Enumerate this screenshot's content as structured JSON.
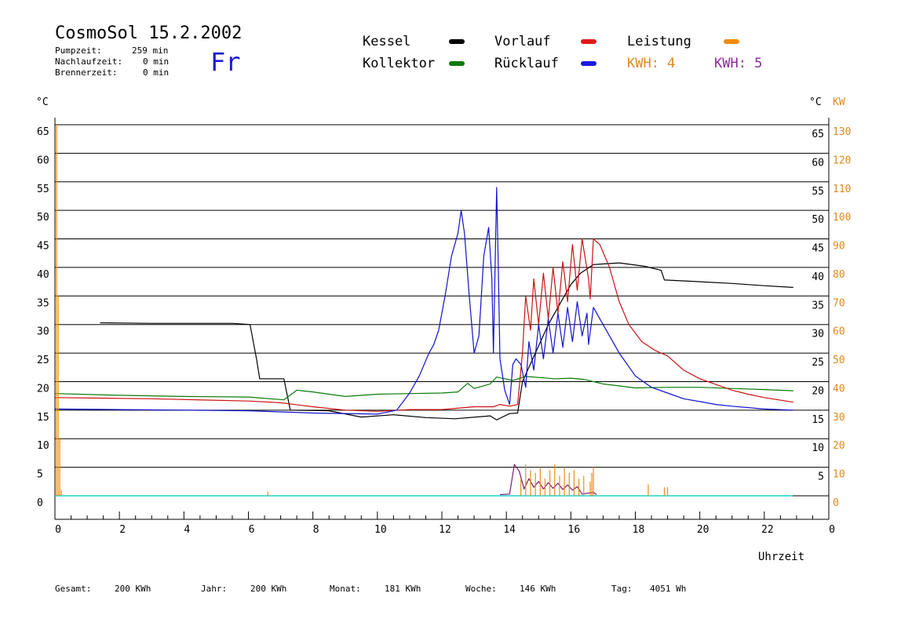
{
  "header": {
    "title": "CosmoSol 15.2.2002",
    "day": "Fr",
    "pump_label": "Pumpzeit:",
    "pump_value": "259 min",
    "nachlauf_label": "Nachlaufzeit:",
    "nachlauf_value": "0 min",
    "brenner_label": "Brennerzeit:",
    "brenner_value": "0 min"
  },
  "legend": {
    "kessel": "Kessel",
    "kollektor": "Kollektor",
    "vorlauf": "Vorlauf",
    "ruecklauf": "Rücklauf",
    "leistung": "Leistung",
    "kwh1": "KWH: 4",
    "kwh2": "KWH: 5"
  },
  "colors": {
    "kessel": "#000000",
    "kollektor": "#0a7a0a",
    "vorlauf": "#cc1111",
    "ruecklauf": "#1111cc",
    "leistung": "#f08c14",
    "kwh1_text": "#e08a20",
    "kwh2_text": "#8a2a9a",
    "kwh2_line": "#7a1a7a",
    "baseline": "#22d0d0"
  },
  "axes": {
    "left_unit": "°C",
    "right_unit_c": "°C",
    "right_unit_kw": "KW",
    "xlabel": "Uhrzeit"
  },
  "footer": {
    "gesamt_label": "Gesamt:",
    "gesamt_value": "200 KWh",
    "jahr_label": "Jahr:",
    "jahr_value": "200 KWh",
    "monat_label": "Monat:",
    "monat_value": "181 KWh",
    "woche_label": "Woche:",
    "woche_value": "146 KWh",
    "tag_label": "Tag:",
    "tag_value": "4051 Wh"
  },
  "chart_data": {
    "type": "line",
    "xlim": [
      0,
      24
    ],
    "ylim": [
      0,
      65
    ],
    "y2lim": [
      0,
      130
    ],
    "grid": true,
    "x_ticks": [
      "0",
      "2",
      "4",
      "6",
      "8",
      "10",
      "12",
      "14",
      "16",
      "18",
      "20",
      "22",
      "0"
    ],
    "y_ticks": [
      "0",
      "5",
      "10",
      "15",
      "20",
      "25",
      "30",
      "35",
      "40",
      "45",
      "50",
      "55",
      "60",
      "65"
    ],
    "y_right_ticks_c": [
      "5",
      "10",
      "15",
      "20",
      "25",
      "30",
      "35",
      "40",
      "45",
      "50",
      "55",
      "60",
      "65"
    ],
    "y_right_ticks_kw": [
      "0",
      "10",
      "20",
      "30",
      "40",
      "50",
      "60",
      "70",
      "80",
      "90",
      "100",
      "110",
      "120",
      "130"
    ],
    "series": [
      {
        "name": "Kessel",
        "color_key": "kessel",
        "points": [
          [
            1.4,
            30.3
          ],
          [
            3,
            30.2
          ],
          [
            5.5,
            30.2
          ],
          [
            6.05,
            30
          ],
          [
            6.25,
            24
          ],
          [
            6.35,
            20.5
          ],
          [
            7.1,
            20.5
          ],
          [
            7.3,
            15
          ],
          [
            8.5,
            14.9
          ],
          [
            9.5,
            13.8
          ],
          [
            10.5,
            14.2
          ],
          [
            11.5,
            13.7
          ],
          [
            12.4,
            13.5
          ],
          [
            13.5,
            14
          ],
          [
            13.7,
            13.3
          ],
          [
            14.1,
            14.4
          ],
          [
            14.35,
            14.5
          ],
          [
            14.5,
            20
          ],
          [
            14.9,
            25
          ],
          [
            15.3,
            30
          ],
          [
            15.7,
            34
          ],
          [
            16,
            37
          ],
          [
            16.3,
            39
          ],
          [
            16.7,
            40.5
          ],
          [
            17.5,
            40.8
          ],
          [
            18.3,
            40.2
          ],
          [
            18.8,
            39.5
          ],
          [
            18.9,
            37.8
          ],
          [
            20,
            37.5
          ],
          [
            21,
            37.2
          ],
          [
            22,
            36.8
          ],
          [
            22.9,
            36.5
          ]
        ]
      },
      {
        "name": "Kollektor",
        "color_key": "kollektor",
        "points": [
          [
            0,
            17.9
          ],
          [
            2,
            17.6
          ],
          [
            4,
            17.4
          ],
          [
            6,
            17.3
          ],
          [
            7.1,
            16.8
          ],
          [
            7.5,
            18.5
          ],
          [
            8,
            18.2
          ],
          [
            9,
            17.4
          ],
          [
            10,
            17.8
          ],
          [
            11,
            17.9
          ],
          [
            12,
            18
          ],
          [
            12.5,
            18.2
          ],
          [
            12.8,
            19.7
          ],
          [
            13,
            18.8
          ],
          [
            13.5,
            19.6
          ],
          [
            13.7,
            20.8
          ],
          [
            14.2,
            20.2
          ],
          [
            14.6,
            20.9
          ],
          [
            15.5,
            20.5
          ],
          [
            16,
            20.6
          ],
          [
            16.4,
            20.4
          ],
          [
            17,
            19.6
          ],
          [
            18,
            18.9
          ],
          [
            19,
            19
          ],
          [
            20,
            19
          ],
          [
            21,
            18.8
          ],
          [
            22,
            18.6
          ],
          [
            22.9,
            18.4
          ]
        ]
      },
      {
        "name": "Vorlauf",
        "color_key": "vorlauf",
        "points": [
          [
            0,
            17.2
          ],
          [
            3,
            17
          ],
          [
            6,
            16.6
          ],
          [
            7,
            16.3
          ],
          [
            8,
            15.6
          ],
          [
            9,
            15
          ],
          [
            10,
            14.8
          ],
          [
            11,
            15.1
          ],
          [
            12,
            15.1
          ],
          [
            13,
            15.6
          ],
          [
            13.6,
            15.6
          ],
          [
            13.8,
            16
          ],
          [
            14.1,
            15.7
          ],
          [
            14.35,
            16
          ],
          [
            14.5,
            25
          ],
          [
            14.6,
            35
          ],
          [
            14.75,
            29
          ],
          [
            14.85,
            38
          ],
          [
            15,
            30
          ],
          [
            15.15,
            39
          ],
          [
            15.3,
            31
          ],
          [
            15.45,
            40
          ],
          [
            15.6,
            32
          ],
          [
            15.75,
            41
          ],
          [
            15.9,
            34
          ],
          [
            16.05,
            44
          ],
          [
            16.2,
            36
          ],
          [
            16.35,
            45
          ],
          [
            16.55,
            38
          ],
          [
            16.6,
            34.5
          ],
          [
            16.7,
            45
          ],
          [
            16.9,
            44
          ],
          [
            17.2,
            40
          ],
          [
            17.5,
            34
          ],
          [
            17.8,
            30
          ],
          [
            18.2,
            27
          ],
          [
            18.6,
            25.5
          ],
          [
            19,
            24.5
          ],
          [
            19.5,
            22
          ],
          [
            20,
            20.5
          ],
          [
            20.5,
            19.5
          ],
          [
            21,
            18.5
          ],
          [
            21.5,
            17.8
          ],
          [
            22,
            17.2
          ],
          [
            22.9,
            16.4
          ]
        ]
      },
      {
        "name": "Rücklauf",
        "color_key": "ruecklauf",
        "points": [
          [
            0,
            15.2
          ],
          [
            2,
            15.1
          ],
          [
            4,
            15
          ],
          [
            6,
            14.9
          ],
          [
            8,
            14.5
          ],
          [
            10,
            14.3
          ],
          [
            10.6,
            15
          ],
          [
            11,
            18
          ],
          [
            11.3,
            21
          ],
          [
            11.6,
            25
          ],
          [
            11.75,
            26.5
          ],
          [
            11.9,
            29
          ],
          [
            12.1,
            35
          ],
          [
            12.3,
            42
          ],
          [
            12.5,
            46
          ],
          [
            12.6,
            50
          ],
          [
            12.7,
            46
          ],
          [
            12.85,
            35
          ],
          [
            13,
            25
          ],
          [
            13.15,
            28
          ],
          [
            13.3,
            42
          ],
          [
            13.45,
            47
          ],
          [
            13.55,
            38
          ],
          [
            13.6,
            25
          ],
          [
            13.65,
            40
          ],
          [
            13.7,
            54
          ],
          [
            13.75,
            40
          ],
          [
            13.8,
            24
          ],
          [
            13.95,
            18.5
          ],
          [
            14.1,
            16
          ],
          [
            14.2,
            23
          ],
          [
            14.3,
            24
          ],
          [
            14.45,
            23
          ],
          [
            14.6,
            19
          ],
          [
            14.7,
            27
          ],
          [
            14.85,
            22
          ],
          [
            15,
            30
          ],
          [
            15.15,
            24
          ],
          [
            15.3,
            31
          ],
          [
            15.45,
            25
          ],
          [
            15.6,
            32
          ],
          [
            15.75,
            26
          ],
          [
            15.9,
            33
          ],
          [
            16.05,
            27
          ],
          [
            16.2,
            34
          ],
          [
            16.35,
            28
          ],
          [
            16.5,
            32
          ],
          [
            16.55,
            26.5
          ],
          [
            16.7,
            33
          ],
          [
            17,
            30
          ],
          [
            17.5,
            25
          ],
          [
            18,
            21
          ],
          [
            18.5,
            19
          ],
          [
            19,
            18
          ],
          [
            19.5,
            17
          ],
          [
            20,
            16.5
          ],
          [
            20.5,
            16
          ],
          [
            21,
            15.7
          ],
          [
            22,
            15.2
          ],
          [
            22.9,
            15
          ]
        ]
      },
      {
        "name": "KWH: 5",
        "color_key": "kwh2_line",
        "points": [
          [
            13.8,
            0.2
          ],
          [
            14.1,
            0.3
          ],
          [
            14.25,
            5.5
          ],
          [
            14.4,
            4.3
          ],
          [
            14.55,
            1.2
          ],
          [
            14.7,
            3
          ],
          [
            14.85,
            1.5
          ],
          [
            15,
            2.5
          ],
          [
            15.15,
            1.2
          ],
          [
            15.3,
            2.3
          ],
          [
            15.45,
            1.3
          ],
          [
            15.6,
            2.2
          ],
          [
            15.75,
            1.1
          ],
          [
            15.9,
            1.9
          ],
          [
            16.05,
            1
          ],
          [
            16.2,
            1.6
          ],
          [
            16.35,
            0.3
          ],
          [
            16.7,
            0.6
          ],
          [
            16.8,
            0.2
          ]
        ]
      }
    ],
    "leistung_spikes_kw": [
      [
        0.05,
        130
      ],
      [
        0.1,
        70
      ],
      [
        0.15,
        20
      ],
      [
        0.2,
        2
      ],
      [
        6.6,
        1.5
      ],
      [
        14.45,
        6
      ],
      [
        14.6,
        11
      ],
      [
        14.75,
        9
      ],
      [
        14.9,
        8
      ],
      [
        15.05,
        10
      ],
      [
        15.2,
        6
      ],
      [
        15.35,
        9
      ],
      [
        15.5,
        11
      ],
      [
        15.65,
        7
      ],
      [
        15.8,
        10
      ],
      [
        15.95,
        8
      ],
      [
        16.1,
        9
      ],
      [
        16.25,
        6
      ],
      [
        16.4,
        7
      ],
      [
        16.6,
        5
      ],
      [
        16.65,
        8
      ],
      [
        16.7,
        10
      ],
      [
        18.4,
        4
      ],
      [
        18.9,
        3
      ],
      [
        19,
        3
      ]
    ]
  }
}
